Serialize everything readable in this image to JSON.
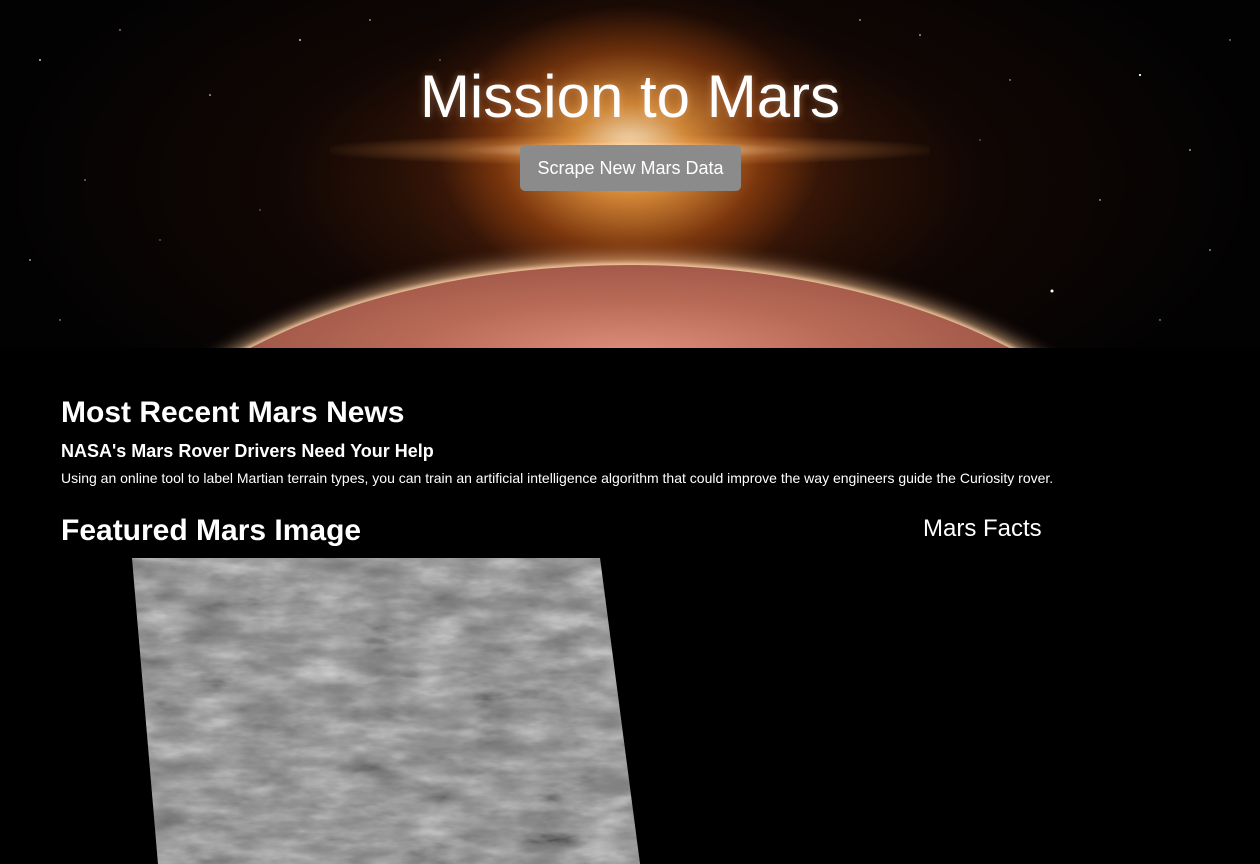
{
  "hero": {
    "title": "Mission to Mars",
    "button_label": "Scrape New Mars Data"
  },
  "news": {
    "heading": "Most Recent Mars News",
    "title": "NASA's Mars Rover Drivers Need Your Help",
    "body": "Using an online tool to label Martian terrain types, you can train an artificial intelligence algorithm that could improve the way engineers guide the Curiosity rover."
  },
  "featured_image": {
    "heading": "Featured Mars Image"
  },
  "facts": {
    "heading": "Mars Facts"
  },
  "colors": {
    "background": "#000000",
    "button": "#8b8b8b",
    "text": "#ffffff"
  }
}
